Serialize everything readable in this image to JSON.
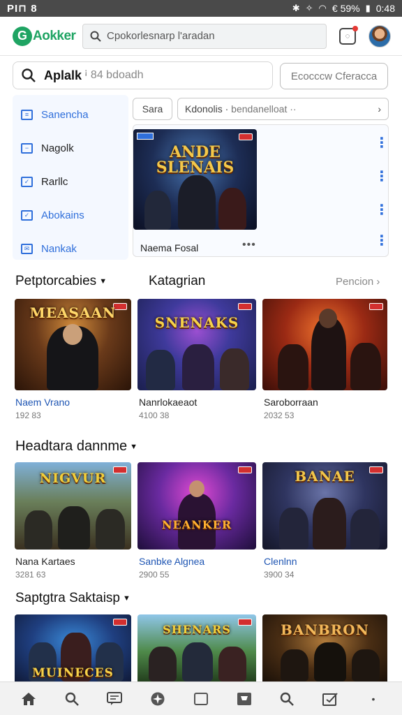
{
  "status_bar": {
    "left": "PI⊓ 8",
    "battery": "€ 59%",
    "time": "0:48"
  },
  "app_bar": {
    "logo_letter": "G",
    "logo_text": "Aokker",
    "search_text": "Cpokorlesnarp l'aradan"
  },
  "main_search": {
    "query": "Aplalk",
    "placeholder": "ꜟ 84 bdoadh"
  },
  "browse_button": "Ecocccw Cferacca",
  "sidebar": {
    "items": [
      {
        "label": "Sanencha",
        "style": "blue"
      },
      {
        "label": "Nagolk",
        "style": "dark"
      },
      {
        "label": "Rarllc",
        "style": "dark"
      },
      {
        "label": "Abokains",
        "style": "blue"
      },
      {
        "label": "Nankak",
        "style": "blue"
      }
    ]
  },
  "chips": {
    "sort": "Sara",
    "filter_label": "Kdonolis ·",
    "filter_value": "bendanelloat ··"
  },
  "featured": {
    "art_title": "ANDE SLENAIS",
    "title": "Naema Fosal",
    "more": "•••"
  },
  "section1": {
    "title": "Petptorcabies",
    "tab": "Katagrian",
    "more": "Pencion"
  },
  "section1_cards": [
    {
      "art": "MEASAAN",
      "name": "Naem Vrano",
      "meta": "192 83",
      "blue": true
    },
    {
      "art": "SNENAKS",
      "name": "Nanrlokaeaot",
      "meta": "4100 38",
      "blue": false
    },
    {
      "art": "",
      "name": "Saroborraan",
      "meta": "2032 53",
      "blue": false
    }
  ],
  "section2": {
    "title": "Headtara dannme"
  },
  "section2_cards": [
    {
      "art": "NIGVUR",
      "name": "Nana Kartaes",
      "meta": "3281 63",
      "blue": false
    },
    {
      "art": "NEANKER",
      "name": "Sanbke Algnea",
      "meta": "2900 55",
      "blue": true
    },
    {
      "art": "BANAE",
      "name": "Clenlnn",
      "meta": "3900 34",
      "blue": true
    }
  ],
  "section3": {
    "title": "Saptgtra Saktaisp"
  },
  "section3_cards": [
    {
      "art": "MUINECES"
    },
    {
      "art": "SHENARS"
    },
    {
      "art": "BANBRON"
    }
  ],
  "bottom_nav": [
    "home-icon",
    "search-icon",
    "messages-icon",
    "compass-icon",
    "library-icon",
    "store-icon",
    "search-icon",
    "tasks-icon",
    "more-icon"
  ]
}
